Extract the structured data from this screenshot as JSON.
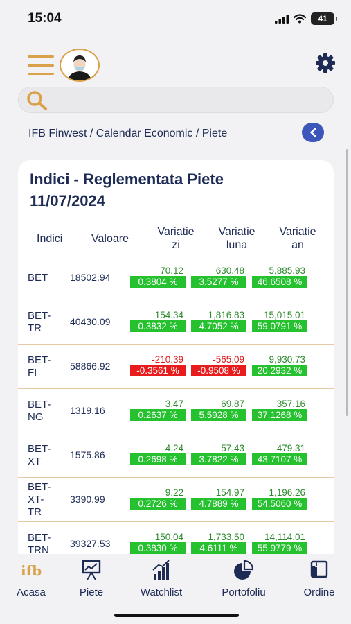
{
  "status": {
    "time": "15:04",
    "battery": "41"
  },
  "breadcrumb": "IFB Finwest / Calendar Economic / Piete",
  "card": {
    "title_line1": "Indici - Reglementata Piete",
    "title_line2": "11/07/2024"
  },
  "table": {
    "headers": {
      "indici": "Indici",
      "valoare": "Valoare",
      "zi_1": "Variatie",
      "zi_2": "zi",
      "luna_1": "Variatie",
      "luna_2": "luna",
      "an_1": "Variatie",
      "an_2": "an"
    },
    "rows": [
      {
        "name": [
          "BET"
        ],
        "value": "18502.94",
        "zi": {
          "abs": "70.12",
          "pct": "0.3804 %",
          "dir": "up"
        },
        "luna": {
          "abs": "630.48",
          "pct": "3.5277 %",
          "dir": "up"
        },
        "an": {
          "abs": "5,885.93",
          "pct": "46.6508 %",
          "dir": "up"
        }
      },
      {
        "name": [
          "BET-",
          "TR"
        ],
        "value": "40430.09",
        "zi": {
          "abs": "154.34",
          "pct": "0.3832 %",
          "dir": "up"
        },
        "luna": {
          "abs": "1,816.83",
          "pct": "4.7052 %",
          "dir": "up"
        },
        "an": {
          "abs": "15,015.01",
          "pct": "59.0791 %",
          "dir": "up"
        }
      },
      {
        "name": [
          "BET-",
          "FI"
        ],
        "value": "58866.92",
        "zi": {
          "abs": "-210.39",
          "pct": "-0.3561 %",
          "dir": "down"
        },
        "luna": {
          "abs": "-565.09",
          "pct": "-0.9508 %",
          "dir": "down"
        },
        "an": {
          "abs": "9,930.73",
          "pct": "20.2932 %",
          "dir": "up"
        }
      },
      {
        "name": [
          "BET-",
          "NG"
        ],
        "value": "1319.16",
        "zi": {
          "abs": "3.47",
          "pct": "0.2637 %",
          "dir": "up"
        },
        "luna": {
          "abs": "69.87",
          "pct": "5.5928 %",
          "dir": "up"
        },
        "an": {
          "abs": "357.16",
          "pct": "37.1268 %",
          "dir": "up"
        }
      },
      {
        "name": [
          "BET-",
          "XT"
        ],
        "value": "1575.86",
        "zi": {
          "abs": "4.24",
          "pct": "0.2698 %",
          "dir": "up"
        },
        "luna": {
          "abs": "57.43",
          "pct": "3.7822 %",
          "dir": "up"
        },
        "an": {
          "abs": "479.31",
          "pct": "43.7107 %",
          "dir": "up"
        }
      },
      {
        "name": [
          "BET-",
          "XT-",
          "TR"
        ],
        "value": "3390.99",
        "zi": {
          "abs": "9.22",
          "pct": "0.2726 %",
          "dir": "up"
        },
        "luna": {
          "abs": "154.97",
          "pct": "4.7889 %",
          "dir": "up"
        },
        "an": {
          "abs": "1,196.26",
          "pct": "54.5060 %",
          "dir": "up"
        }
      },
      {
        "name": [
          "BET-",
          "TRN"
        ],
        "value": "39327.53",
        "zi": {
          "abs": "150.04",
          "pct": "0.3830 %",
          "dir": "up"
        },
        "luna": {
          "abs": "1,733.50",
          "pct": "4.6111 %",
          "dir": "up"
        },
        "an": {
          "abs": "14,114.01",
          "pct": "55.9779 %",
          "dir": "up"
        }
      }
    ]
  },
  "colors": {
    "accent_gold": "#d9a24a",
    "navy": "#1d2b55",
    "positive": "#25c12f",
    "negative": "#e81c1c",
    "back_button": "#3c57b9"
  },
  "icons": {
    "menu": "hamburger-icon",
    "profile": "avatar",
    "settings": "gear-icon",
    "search": "search-icon",
    "back": "chevron-left-icon"
  },
  "tabs": [
    {
      "label": "Acasa",
      "icon": "ifb-logo-icon"
    },
    {
      "label": "Piete",
      "icon": "presentation-chart-icon"
    },
    {
      "label": "Watchlist",
      "icon": "bar-chart-icon"
    },
    {
      "label": "Portofoliu",
      "icon": "pie-chart-icon"
    },
    {
      "label": "Ordine",
      "icon": "orders-icon"
    }
  ]
}
